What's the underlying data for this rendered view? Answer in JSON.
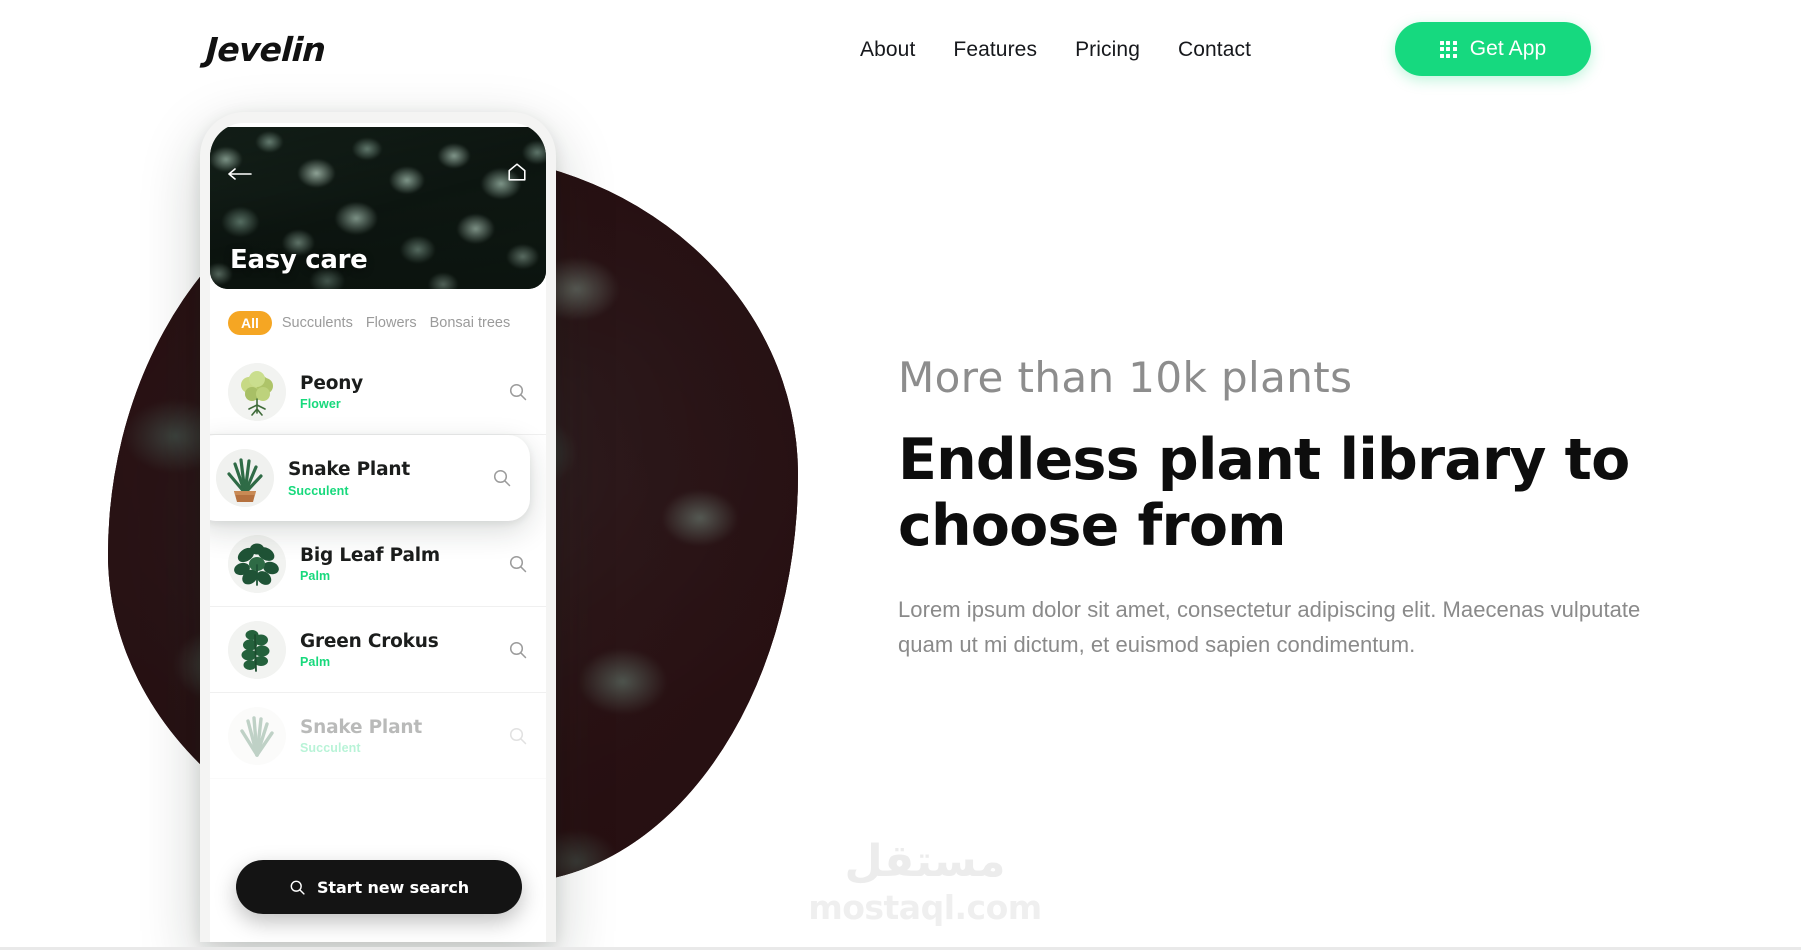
{
  "brand": {
    "name": "Jevelin"
  },
  "nav": {
    "items": [
      {
        "label": "About"
      },
      {
        "label": "Features"
      },
      {
        "label": "Pricing"
      },
      {
        "label": "Contact"
      }
    ],
    "cta": {
      "label": "Get App",
      "icon": "grid-icon",
      "color": "#16d97f"
    }
  },
  "hero": {
    "eyebrow": "More than 10k plants",
    "headline": "Endless plant library to choose from",
    "body": "Lorem ipsum dolor sit amet, consectetur adipiscing elit. Maecenas vulputate quam ut mi dictum, et euismod sapien condimentum."
  },
  "phone": {
    "hero_title": "Easy care",
    "back_icon": "arrow-left-icon",
    "home_icon": "home-icon",
    "filters": [
      {
        "label": "All",
        "active": true
      },
      {
        "label": "Succulents",
        "active": false
      },
      {
        "label": "Flowers",
        "active": false
      },
      {
        "label": "Bonsai trees",
        "active": false
      }
    ],
    "plants": [
      {
        "name": "Peony",
        "type": "Flower"
      },
      {
        "name": "Snake Plant",
        "type": "Succulent"
      },
      {
        "name": "Big Leaf Palm",
        "type": "Palm"
      },
      {
        "name": "Green Crokus",
        "type": "Palm"
      },
      {
        "name": "Snake Plant",
        "type": "Succulent"
      }
    ],
    "search_button": {
      "label": "Start new search",
      "icon": "search-icon"
    }
  },
  "watermark": {
    "arabic": "مستقل",
    "latin": "mostaql.com"
  },
  "colors": {
    "accent_green": "#16d97f",
    "chip_orange": "#f5a623",
    "plant_type_green": "#17d97c",
    "dark": "#141414"
  }
}
